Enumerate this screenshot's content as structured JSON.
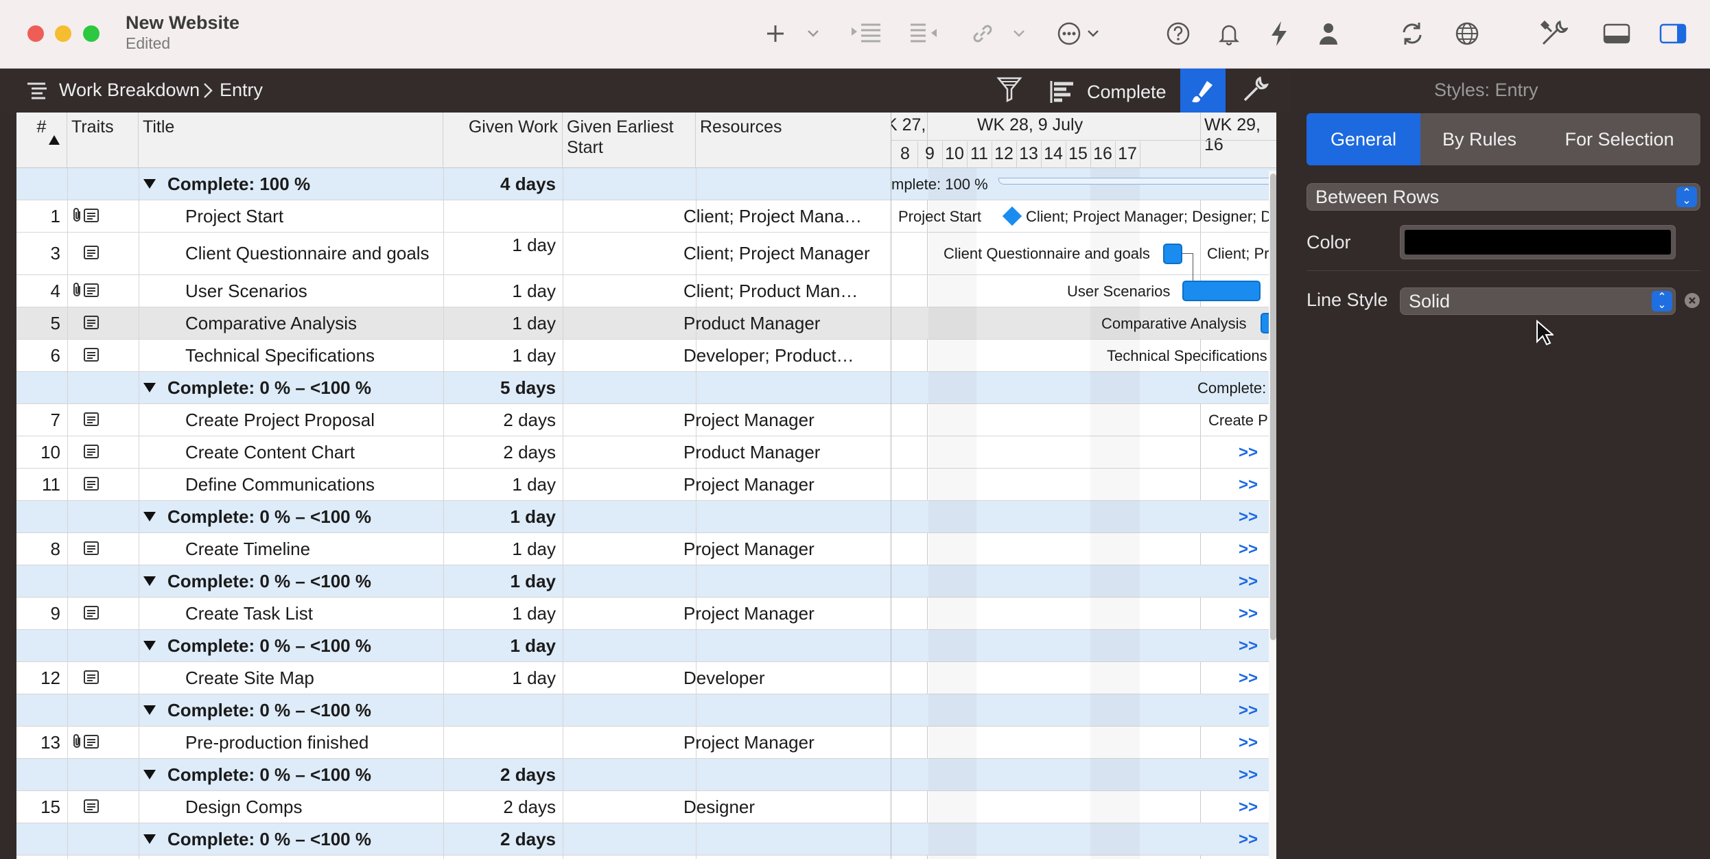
{
  "window": {
    "title": "New Website",
    "subtitle": "Edited"
  },
  "toolbar": {
    "icons": [
      "add-icon",
      "chevron-down-icon",
      "indent-icon",
      "outdent-icon",
      "link-icon",
      "chevron-down-icon",
      "more-icon",
      "chevron-down-icon",
      "help-icon",
      "bell-icon",
      "bolt-icon",
      "person-icon",
      "refresh-icon",
      "globe-icon",
      "tools-icon",
      "bottom-panel-icon",
      "sidebar-icon"
    ]
  },
  "subbar": {
    "breadcrumb_root": "Work Breakdown",
    "breadcrumb_leaf": "Entry",
    "filter_label": "Complete"
  },
  "outline": {
    "columns": {
      "num": "#",
      "traits": "Traits",
      "title": "Title",
      "given_work": "Given Work",
      "given_earliest_start": "Given Earliest Start",
      "resources": "Resources"
    },
    "rows": [
      {
        "type": "group",
        "title": "Complete: 100 %",
        "work": "4 days"
      },
      {
        "type": "task",
        "num": "1",
        "traits": "clip+note",
        "title": "Project Start",
        "work": "",
        "res": "Client; Project Mana…"
      },
      {
        "type": "task",
        "num": "3",
        "traits": "note",
        "title": "Client Questionnaire and goals",
        "work": "1 day",
        "res": "Client; Project Manager",
        "tall": true
      },
      {
        "type": "task",
        "num": "4",
        "traits": "clip+note",
        "title": "User Scenarios",
        "work": "1 day",
        "res": "Client; Product Man…"
      },
      {
        "type": "task",
        "num": "5",
        "traits": "note",
        "title": "Comparative Analysis",
        "work": "1 day",
        "res": "Product Manager",
        "selected": true
      },
      {
        "type": "task",
        "num": "6",
        "traits": "note",
        "title": "Technical Specifications",
        "work": "1 day",
        "res": "Developer; Product…"
      },
      {
        "type": "group",
        "title": "Complete: 0 % – <100 %",
        "work": "5 days"
      },
      {
        "type": "task",
        "num": "7",
        "traits": "note",
        "title": "Create Project Proposal",
        "work": "2 days",
        "res": "Project Manager"
      },
      {
        "type": "task",
        "num": "10",
        "traits": "note",
        "title": "Create Content Chart",
        "work": "2 days",
        "res": "Product Manager"
      },
      {
        "type": "task",
        "num": "11",
        "traits": "note",
        "title": "Define Communications",
        "work": "1 day",
        "res": "Project Manager"
      },
      {
        "type": "group",
        "title": "Complete: 0 % – <100 %",
        "work": "1 day"
      },
      {
        "type": "task",
        "num": "8",
        "traits": "note",
        "title": "Create Timeline",
        "work": "1 day",
        "res": "Project Manager"
      },
      {
        "type": "group",
        "title": "Complete: 0 % – <100 %",
        "work": "1 day"
      },
      {
        "type": "task",
        "num": "9",
        "traits": "note",
        "title": "Create Task List",
        "work": "1 day",
        "res": "Project Manager"
      },
      {
        "type": "group",
        "title": "Complete: 0 % – <100 %",
        "work": "1 day"
      },
      {
        "type": "task",
        "num": "12",
        "traits": "note",
        "title": "Create Site Map",
        "work": "1 day",
        "res": "Developer"
      },
      {
        "type": "group",
        "title": "Complete: 0 % – <100 %",
        "work": ""
      },
      {
        "type": "task",
        "num": "13",
        "traits": "clip+note",
        "title": "Pre-production finished",
        "work": "",
        "res": "Project Manager"
      },
      {
        "type": "group",
        "title": "Complete: 0 % – <100 %",
        "work": "2 days"
      },
      {
        "type": "task",
        "num": "15",
        "traits": "note",
        "title": "Design Comps",
        "work": "2 days",
        "res": "Designer"
      },
      {
        "type": "group",
        "title": "Complete: 0 % – <100 %",
        "work": "2 days"
      }
    ]
  },
  "gantt": {
    "weeks": [
      "K 27,",
      "WK 28, 9 July",
      "WK 29, 16"
    ],
    "days": [
      "8",
      "9",
      "10",
      "11",
      "12",
      "13",
      "14",
      "15",
      "16",
      "17"
    ],
    "labels": {
      "group_complete": "mplete: 100 %",
      "project_start": "Project Start",
      "project_start_res": "Client; Project Manager; Designer; D",
      "questionnaire": "Client Questionnaire and goals",
      "questionnaire_res": "Client; Pr",
      "user_scenarios": "User Scenarios",
      "comparative": "Comparative Analysis",
      "technical": "Technical Specifications",
      "group2": "Complete:",
      "proposal": "Create P",
      "more": ">>"
    }
  },
  "inspector": {
    "title": "Styles: Entry",
    "tabs": [
      "General",
      "By Rules",
      "For Selection"
    ],
    "active_tab": "General",
    "section_popup": "Between Rows",
    "color_label": "Color",
    "color_value": "#000000",
    "line_style_label": "Line Style",
    "line_style_value": "Solid"
  },
  "colors": {
    "accent": "#1d69e0",
    "gantt_bar": "#1a8cf0",
    "group_row": "#deebf8"
  }
}
